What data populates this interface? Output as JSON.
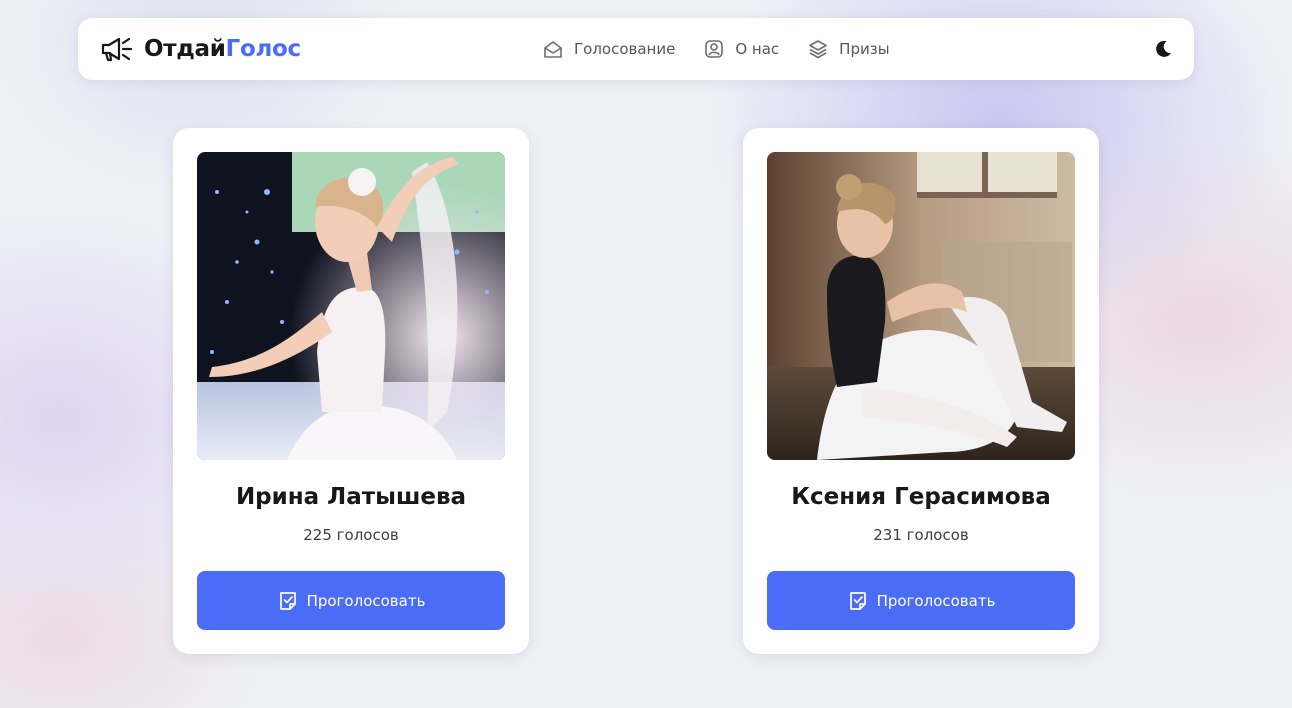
{
  "brand": {
    "part1": "Отдай",
    "part2": "Голос",
    "icon": "megaphone-icon",
    "accent_color": "#4a6cf7"
  },
  "nav": {
    "items": [
      {
        "label": "Голосование",
        "icon": "ballot-box-icon"
      },
      {
        "label": "О нас",
        "icon": "user-icon"
      },
      {
        "label": "Призы",
        "icon": "layers-icon"
      }
    ]
  },
  "theme_toggle": {
    "icon": "moon-icon"
  },
  "participants": [
    {
      "name": "Ирина Латышева",
      "votes": "225 голосов",
      "button_label": "Проголосовать",
      "button_icon": "vote-check-icon",
      "photo": "ballerina-photo"
    },
    {
      "name": "Ксения Герасимова",
      "votes": "231 голосов",
      "button_label": "Проголосовать",
      "button_icon": "vote-check-icon",
      "photo": "ballerina-photo"
    }
  ]
}
